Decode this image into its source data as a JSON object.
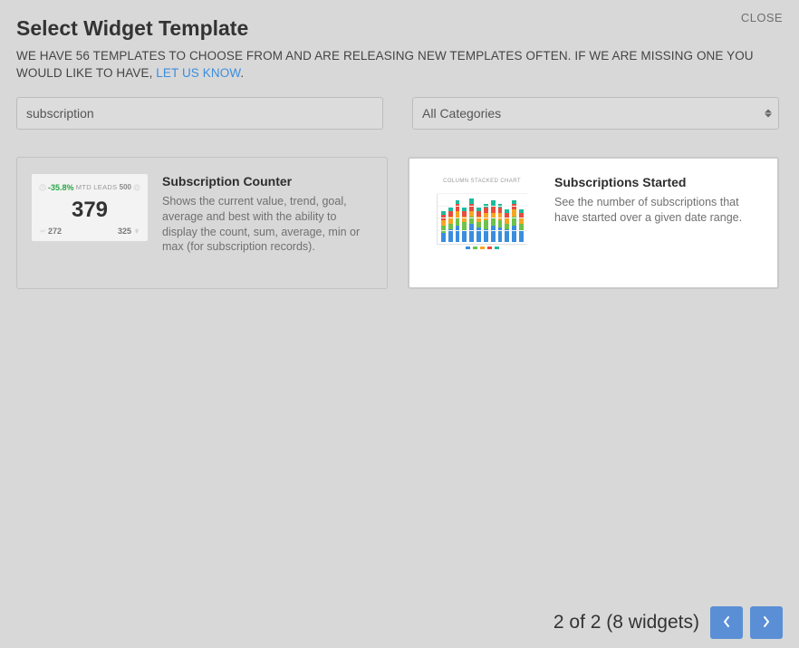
{
  "modal": {
    "close_label": "CLOSE",
    "title": "Select Widget Template",
    "subtitle_pre": "WE HAVE 56 TEMPLATES TO CHOOSE FROM AND ARE RELEASING NEW TEMPLATES OFTEN. IF WE ARE MISSING ONE YOU WOULD LIKE TO HAVE, ",
    "subtitle_link": "LET US KNOW",
    "subtitle_post": "."
  },
  "controls": {
    "search_value": "subscription",
    "category_selected": "All Categories"
  },
  "cards": {
    "counter": {
      "title": "Subscription Counter",
      "desc": "Shows the current value, trend, goal, average and best with the ability to display the count, sum, average, min or max (for subscription records).",
      "thumb": {
        "pct": "-35.8%",
        "label": "MTD LEADS",
        "goal": "500",
        "main": "379",
        "avg": "272",
        "best": "325"
      }
    },
    "started": {
      "title": "Subscriptions Started",
      "desc": "See the number of subscriptions that have started over a given date range.",
      "thumb": {
        "title": "COLUMN STACKED CHART"
      }
    }
  },
  "footer": {
    "status": "2 of 2 (8 widgets)"
  },
  "chart_data": {
    "type": "bar",
    "stacked": true,
    "title": "COLUMN STACKED CHART",
    "series_names": [
      "blue",
      "green",
      "orange",
      "red",
      "teal"
    ],
    "colors": [
      "#3b8dde",
      "#6cc24a",
      "#f5a623",
      "#e74c3c",
      "#1abc9c"
    ],
    "columns": [
      [
        10,
        8,
        6,
        6,
        4
      ],
      [
        14,
        6,
        8,
        6,
        4
      ],
      [
        18,
        8,
        8,
        8,
        4
      ],
      [
        12,
        10,
        6,
        6,
        4
      ],
      [
        20,
        8,
        6,
        8,
        6
      ],
      [
        16,
        6,
        6,
        6,
        4
      ],
      [
        14,
        10,
        8,
        6,
        4
      ],
      [
        18,
        8,
        6,
        8,
        6
      ],
      [
        16,
        8,
        8,
        6,
        4
      ],
      [
        14,
        6,
        6,
        6,
        4
      ],
      [
        18,
        10,
        8,
        6,
        4
      ],
      [
        12,
        8,
        6,
        6,
        4
      ]
    ]
  }
}
